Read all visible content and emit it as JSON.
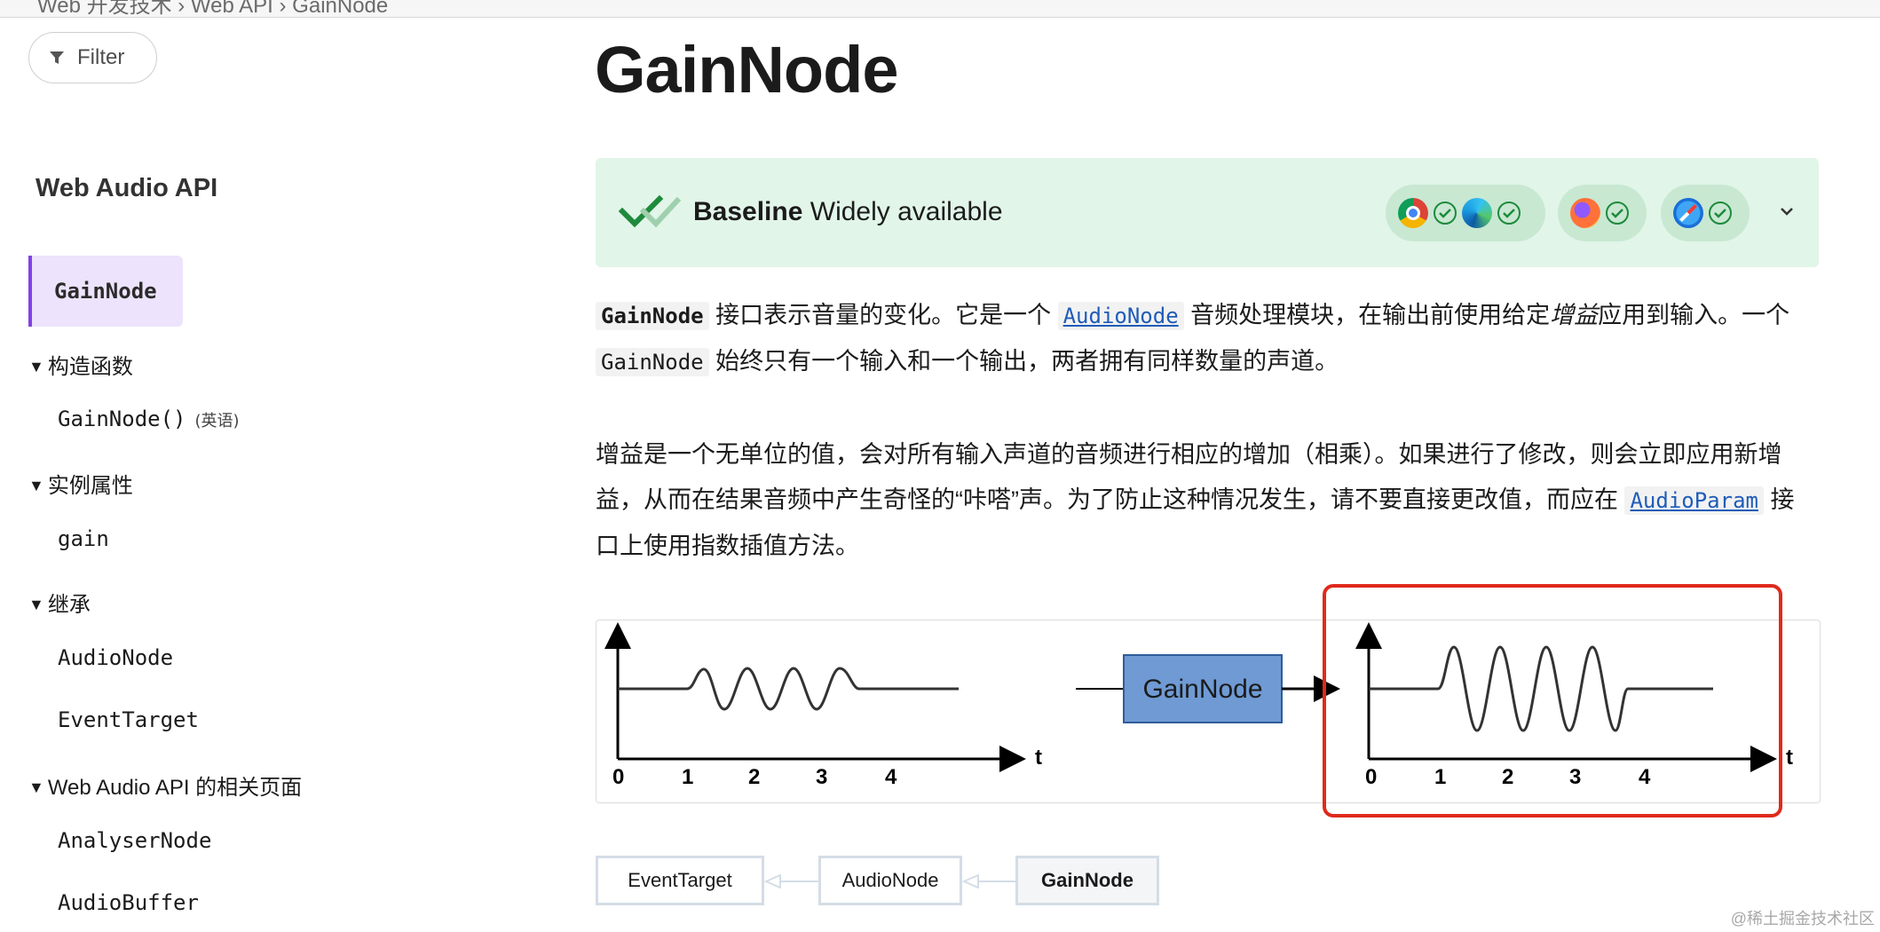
{
  "topbar": {
    "text": "Web 开发技术 › Web API › GainNode"
  },
  "sidebar": {
    "filter_label": "Filter",
    "title": "Web Audio API",
    "active": "GainNode",
    "sections": [
      {
        "label": "构造函数",
        "items": [
          {
            "label": "GainNode()",
            "note": "(英语)"
          }
        ]
      },
      {
        "label": "实例属性",
        "items": [
          {
            "label": "gain"
          }
        ]
      },
      {
        "label": "继承",
        "items": [
          {
            "label": "AudioNode"
          },
          {
            "label": "EventTarget"
          }
        ]
      },
      {
        "label": "Web Audio API 的相关页面",
        "items": [
          {
            "label": "AnalyserNode"
          },
          {
            "label": "AudioBuffer"
          }
        ]
      }
    ]
  },
  "main": {
    "title": "GainNode",
    "baseline": {
      "strong": "Baseline",
      "text": "Widely available",
      "browsers": [
        "chrome",
        "edge",
        "firefox",
        "safari"
      ]
    },
    "p1": {
      "code1": "GainNode",
      "t1": " 接口表示音量的变化。它是一个 ",
      "link1": "AudioNode",
      "t2": " 音频处理模块，在输出前使用给定",
      "em": "增益",
      "t3": "应用到输入。一个 ",
      "code2": "GainNode",
      "t4": " 始终只有一个输入和一个输出，两者拥有同样数量的声道。"
    },
    "p2": {
      "t1": "增益是一个无单位的值，会对所有输入声道的音频进行相应的增加（相乘）。如果进行了修改，则会立即应用新增益，从而在结果音频中产生奇怪的“咔嗒”声。为了防止这种情况发生，请不要直接更改值，而应在 ",
      "link": "AudioParam",
      "t2": " 接口上使用指数插值方法。"
    },
    "diagram": {
      "node_label": "GainNode",
      "axis_t": "t",
      "ticks": [
        "0",
        "1",
        "2",
        "3",
        "4"
      ]
    },
    "inheritance": [
      "EventTarget",
      "AudioNode",
      "GainNode"
    ]
  },
  "watermark": "@稀土掘金技术社区",
  "colors": {
    "accent": "#8142e6",
    "baseline_bg": "#e1f5e8",
    "link": "#1f5cb8",
    "highlight": "#e02a1b",
    "gain_box": "#6f9ad3"
  }
}
